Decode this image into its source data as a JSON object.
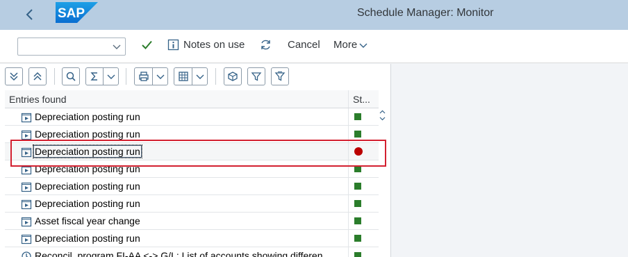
{
  "shell": {
    "title": "Schedule Manager: Monitor",
    "logo_text": "SAP",
    "color": "#b7cde2"
  },
  "toolbar": {
    "dropdown_value": "",
    "notes_label": "Notes on use",
    "cancel_label": "Cancel",
    "more_label": "More"
  },
  "icons": {
    "back": "chevron-left-icon",
    "check": "checkmark-icon",
    "notes": "info-icon",
    "refresh": "refresh-icon",
    "expand_all": "expand-all-icon",
    "collapse_all": "collapse-all-icon",
    "find": "search-icon",
    "sum": "sigma-icon",
    "print": "print-icon",
    "layout": "layout-icon",
    "settings": "cube-icon",
    "filter": "filter-icon",
    "filter_advanced": "filter-settings-icon"
  },
  "table": {
    "headers": [
      "Entries found",
      "St..."
    ],
    "rows": [
      {
        "label": "Depreciation posting run",
        "status": "green"
      },
      {
        "label": "Depreciation posting run",
        "status": "green"
      },
      {
        "label": "Depreciation posting run",
        "status": "red"
      },
      {
        "label": "Depreciation posting run",
        "status": "green"
      },
      {
        "label": "Depreciation posting run",
        "status": "green"
      },
      {
        "label": "Depreciation posting run",
        "status": "green"
      },
      {
        "label": "Asset fiscal year change",
        "status": "green"
      },
      {
        "label": "Depreciation posting run",
        "status": "green"
      },
      {
        "label": "Reconcil. program FI-AA <-> G/L: List of accounts showing differen",
        "status": "green"
      }
    ]
  },
  "colors": {
    "status_green": "#2b7d2b",
    "status_red": "#bb0000",
    "highlight": "#d32030"
  }
}
